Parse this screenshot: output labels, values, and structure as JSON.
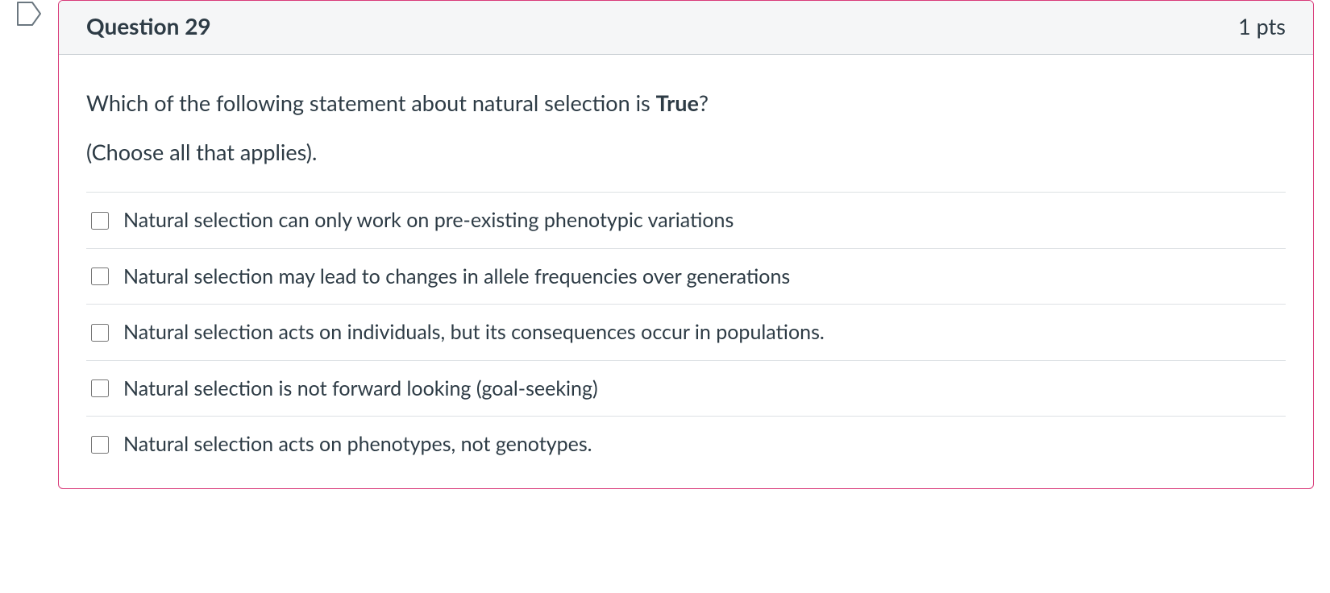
{
  "question": {
    "title": "Question 29",
    "points": "1 pts",
    "prompt_line1_prefix": "Which of the following statement about natural selection is ",
    "prompt_line1_bold": "True",
    "prompt_line1_suffix": "?",
    "prompt_line2": "(Choose all that applies).",
    "answers": [
      {
        "label": "Natural selection can only work on pre-existing phenotypic variations"
      },
      {
        "label": "Natural selection may lead to changes in allele frequencies over generations"
      },
      {
        "label": "Natural selection acts on individuals, but its consequences occur in populations."
      },
      {
        "label": "Natural selection is not forward looking (goal-seeking)"
      },
      {
        "label": "Natural selection acts on phenotypes, not genotypes."
      }
    ]
  }
}
